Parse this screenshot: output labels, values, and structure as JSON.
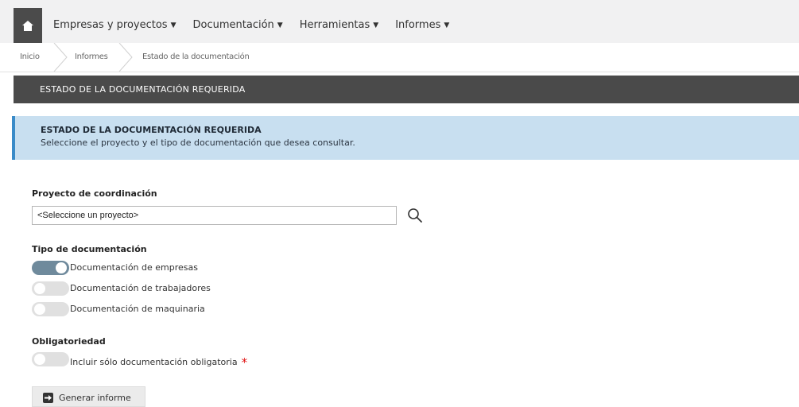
{
  "nav": {
    "home_icon": "home-icon",
    "menu": [
      {
        "label": "Empresas y proyectos"
      },
      {
        "label": "Documentación"
      },
      {
        "label": "Herramientas"
      },
      {
        "label": "Informes"
      }
    ]
  },
  "breadcrumb": [
    "Inicio",
    "Informes",
    "Estado de la documentación"
  ],
  "page_title": "ESTADO DE LA DOCUMENTACIÓN REQUERIDA",
  "info": {
    "title": "ESTADO DE LA DOCUMENTACIÓN REQUERIDA",
    "text": "Seleccione el proyecto y el tipo de documentación que desea consultar."
  },
  "project": {
    "label": "Proyecto de coordinación",
    "select_value": "<Seleccione un proyecto>",
    "search_icon": "search-icon"
  },
  "doc_type": {
    "label": "Tipo de documentación",
    "options": [
      {
        "label": "Documentación de empresas",
        "checked": true
      },
      {
        "label": "Documentación de trabajadores",
        "checked": false
      },
      {
        "label": "Documentación de maquinaria",
        "checked": false
      }
    ]
  },
  "mandatory": {
    "label": "Obligatoriedad",
    "option_label": "Incluir sólo documentación obligatoria",
    "checked": false,
    "required_mark": "*"
  },
  "generate_button": {
    "label": "Generar informe",
    "icon": "arrow-right-icon"
  },
  "colors": {
    "nav_bg": "#f1f1f2",
    "title_bar": "#4a4a4a",
    "info_bg": "#c8dff0",
    "info_border": "#3a8bc8",
    "toggle_on": "#6f8a9c",
    "toggle_off": "#e0e0e0",
    "required": "#e01010"
  }
}
